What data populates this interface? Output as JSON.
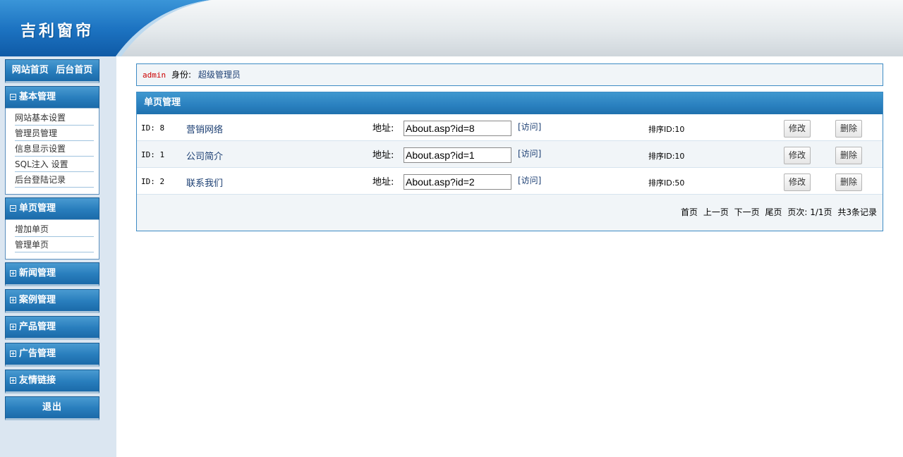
{
  "header": {
    "site_title": "吉利窗帘"
  },
  "sidebar": {
    "home_links": [
      "网站首页",
      "后台首页"
    ],
    "groups": [
      {
        "title": "基本管理",
        "expanded": true,
        "items": [
          "网站基本设置",
          "管理员管理",
          "信息显示设置",
          "SQL注入 设置",
          "后台登陆记录"
        ]
      },
      {
        "title": "单页管理",
        "expanded": true,
        "items": [
          "增加单页",
          "管理单页"
        ]
      },
      {
        "title": "新闻管理",
        "expanded": false,
        "items": []
      },
      {
        "title": "案例管理",
        "expanded": false,
        "items": []
      },
      {
        "title": "产品管理",
        "expanded": false,
        "items": []
      },
      {
        "title": "广告管理",
        "expanded": false,
        "items": []
      },
      {
        "title": "友情链接",
        "expanded": false,
        "items": []
      }
    ],
    "logout_label": "退出"
  },
  "info_bar": {
    "user": "admin",
    "role_label": "身份:",
    "role": "超级管理员"
  },
  "panel": {
    "title": "单页管理",
    "rows": [
      {
        "id_text": "ID: 8",
        "name": "营销网络",
        "addr_label": "地址:",
        "url": "About.asp?id=8",
        "visit": "[访问]",
        "sort": "排序ID:10",
        "edit": "修改",
        "del": "删除"
      },
      {
        "id_text": "ID: 1",
        "name": "公司简介",
        "addr_label": "地址:",
        "url": "About.asp?id=1",
        "visit": "[访问]",
        "sort": "排序ID:10",
        "edit": "修改",
        "del": "删除"
      },
      {
        "id_text": "ID: 2",
        "name": "联系我们",
        "addr_label": "地址:",
        "url": "About.asp?id=2",
        "visit": "[访问]",
        "sort": "排序ID:50",
        "edit": "修改",
        "del": "删除"
      }
    ],
    "pager": {
      "first": "首页",
      "prev": "上一页",
      "next": "下一页",
      "last": "尾页",
      "page_info": "页次: 1/1页",
      "total": "共3条记录"
    }
  },
  "colors": {
    "accent": "#2a80bf",
    "user_name": "#cc0000",
    "link": "#1c3f73",
    "sidebar_bg": "#dbe6f1"
  }
}
